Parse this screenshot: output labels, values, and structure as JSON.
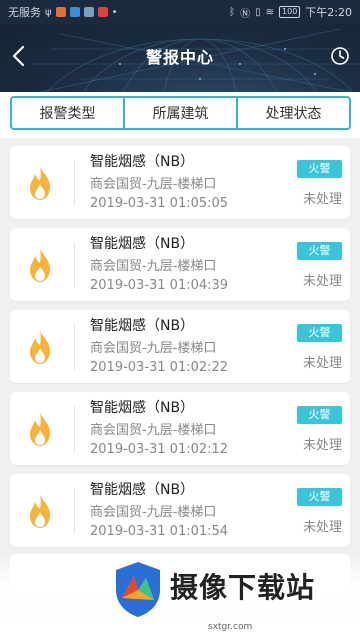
{
  "status_bar": {
    "carrier": "无服务",
    "time": "下午2:20",
    "battery": "100"
  },
  "header": {
    "title": "警报中心"
  },
  "filters": [
    {
      "label": "报警类型"
    },
    {
      "label": "所属建筑"
    },
    {
      "label": "处理状态"
    }
  ],
  "alarms": [
    {
      "name": "智能烟感（NB）",
      "location": "商会国贸-九层-楼梯口",
      "time": "2019-03-31 01:05:05",
      "type": "火警",
      "status": "未处理"
    },
    {
      "name": "智能烟感（NB）",
      "location": "商会国贸-九层-楼梯口",
      "time": "2019-03-31 01:04:39",
      "type": "火警",
      "status": "未处理"
    },
    {
      "name": "智能烟感（NB）",
      "location": "商会国贸-九层-楼梯口",
      "time": "2019-03-31 01:02:22",
      "type": "火警",
      "status": "未处理"
    },
    {
      "name": "智能烟感（NB）",
      "location": "商会国贸-九层-楼梯口",
      "time": "2019-03-31 01:02:12",
      "type": "火警",
      "status": "未处理"
    },
    {
      "name": "智能烟感（NB）",
      "location": "商会国贸-九层-楼梯口",
      "time": "2019-03-31 01:01:54",
      "type": "火警",
      "status": "未处理"
    }
  ],
  "watermark": {
    "text": "摄像下载站",
    "url": "sxtgr.com"
  },
  "colors": {
    "accent": "#3bb3c8",
    "badge": "#3bc4d8",
    "flame": "#f6b23a",
    "header_bg": "#1b2b40"
  },
  "icons": {
    "back": "chevron-left-icon",
    "history": "clock-icon",
    "alarm": "flame-icon"
  }
}
